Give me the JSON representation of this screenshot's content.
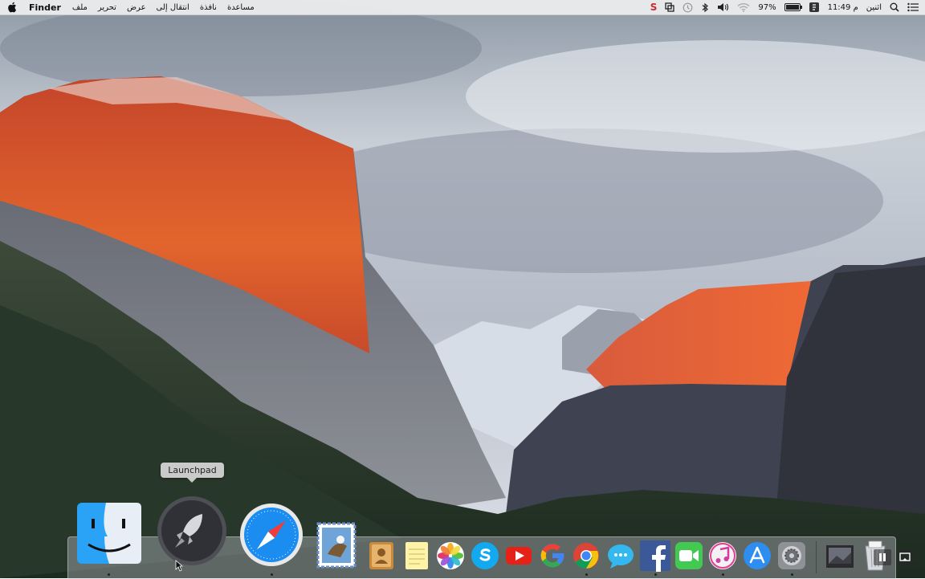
{
  "menubar": {
    "app_name": "Finder",
    "menus": [
      "ملف",
      "تحرير",
      "عرض",
      "انتقال إلى",
      "نافذة",
      "مساعدة"
    ],
    "battery_percent": "97%",
    "battery_level": 0.97,
    "clock": "11:49 م",
    "day": "اثنين",
    "status_icons": [
      "s-badge-icon",
      "window-copy-icon",
      "time-machine-icon",
      "bluetooth-icon",
      "volume-icon",
      "wifi-icon",
      "battery-icon",
      "user-icon",
      "search-icon",
      "list-icon"
    ],
    "s_badge": "S"
  },
  "dock": {
    "tooltip": "Launchpad",
    "items": [
      "Finder",
      "Launchpad",
      "Safari",
      "Mail",
      "Contacts",
      "Notes",
      "Photos",
      "Skype",
      "YouTube",
      "Google",
      "Chrome",
      "Messages",
      "Facebook",
      "FaceTime",
      "iTunes",
      "App Store",
      "System Preferences",
      "Photo Browser",
      "Trash"
    ]
  },
  "colors": {
    "menubar_bg": "#eeeeee",
    "s_badge": "#d0282e"
  }
}
